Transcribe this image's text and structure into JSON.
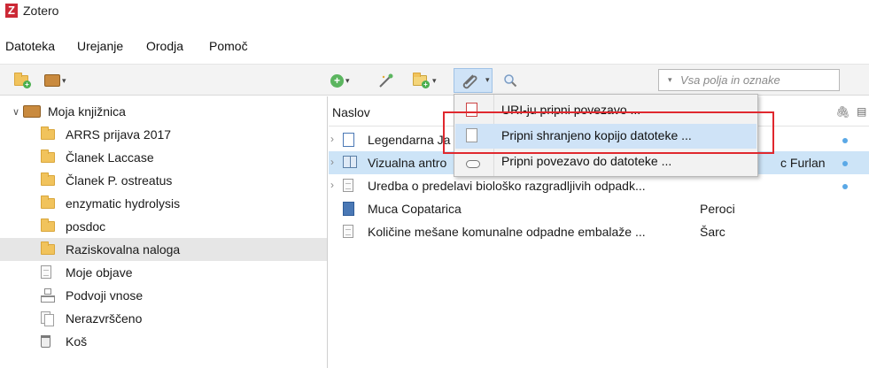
{
  "app": {
    "title": "Zotero",
    "logo_letter": "Z"
  },
  "menubar": {
    "items": [
      {
        "label": "Datoteka"
      },
      {
        "label": "Urejanje"
      },
      {
        "label": "Orodja"
      },
      {
        "label": "Pomoč"
      }
    ]
  },
  "toolbar": {
    "search_placeholder": "Vsa polja in oznake"
  },
  "library": {
    "root_label": "Moja knjižnica",
    "collections": [
      {
        "label": "ARRS prijava 2017"
      },
      {
        "label": "Članek Laccase"
      },
      {
        "label": "Članek P. ostreatus"
      },
      {
        "label": "enzymatic hydrolysis"
      },
      {
        "label": "posdoc"
      },
      {
        "label": "Raziskovalna naloga"
      }
    ],
    "special": [
      {
        "label": "Moje objave"
      },
      {
        "label": "Podvoji vnose"
      },
      {
        "label": "Nerazvrščeno"
      },
      {
        "label": "Koš"
      }
    ]
  },
  "items_table": {
    "column_title": "Naslov",
    "rows": [
      {
        "title": "Legendarna Ja",
        "creator": ""
      },
      {
        "title": "Vizualna antro",
        "creator": "c Furlan"
      },
      {
        "title": "Uredba o predelavi biološko razgradljivih odpadk...",
        "creator": ""
      },
      {
        "title": "Muca Copatarica",
        "creator": "Peroci"
      },
      {
        "title": "Količine mešane komunalne odpadne embalaže ...",
        "creator": "Šarc"
      }
    ]
  },
  "attach_menu": {
    "items": [
      {
        "label": "URI-ju pripni povezavo ..."
      },
      {
        "label": "Pripni shranjeno kopijo datoteke ..."
      },
      {
        "label": "Pripni povezavo do datoteke ..."
      }
    ]
  },
  "colors": {
    "selection": "#cde4f7",
    "highlight_border": "#e0282e",
    "logo": "#cc2936"
  }
}
